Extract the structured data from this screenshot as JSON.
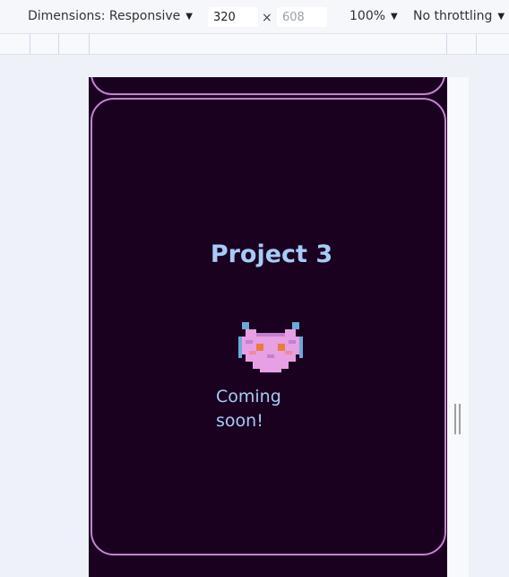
{
  "toolbar": {
    "dimensions_label": "Dimensions: Responsive",
    "width_value": "320",
    "height_placeholder": "608",
    "times": "×",
    "zoom": "100%",
    "throttling": "No throttling"
  },
  "card": {
    "title": "Project 3",
    "description": "Coming soon!"
  },
  "icons": [
    "chevron-down-icon",
    "cat-heart-icon",
    "resize-handle-icon"
  ],
  "colors": {
    "page_background": "#1a0120",
    "card_border": "#c583d0",
    "card_text": "#a7cbf6"
  }
}
